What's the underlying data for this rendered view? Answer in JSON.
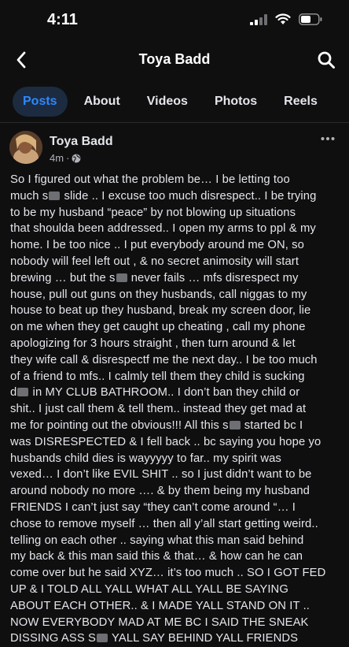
{
  "status_bar": {
    "time": "4:11"
  },
  "nav": {
    "title": "Toya Badd",
    "back_icon": "chevron-left-icon",
    "search_icon": "search-icon"
  },
  "tabs": [
    {
      "label": "Posts",
      "active": true
    },
    {
      "label": "About",
      "active": false
    },
    {
      "label": "Videos",
      "active": false
    },
    {
      "label": "Photos",
      "active": false
    },
    {
      "label": "Reels",
      "active": false
    }
  ],
  "post": {
    "author": "Toya Badd",
    "time": "4m",
    "separator": "·",
    "audience_icon": "globe-icon",
    "more_icon": "more-horizontal-icon",
    "body_lines": [
      [
        "So I figured out what the problem be… I be letting too"
      ],
      [
        "much s",
        " slide .. I excuse too much disrespect.. I be trying"
      ],
      [
        "to be my husband “peace” by not blowing up situations"
      ],
      [
        "that shoulda been addressed.. I open my arms to ppl & my"
      ],
      [
        "home. I be too nice .. I put everybody around me ON, so"
      ],
      [
        "nobody will feel left out , & no secret animosity will start"
      ],
      [
        "brewing … but the s",
        " never fails … mfs disrespect my"
      ],
      [
        "house, pull out guns on they husbands, call niggas to my"
      ],
      [
        "house to beat up they husband, break my screen door, lie"
      ],
      [
        "on me when they get caught up cheating , call my phone"
      ],
      [
        "apologizing for 3 hours straight , then turn around & let"
      ],
      [
        "they wife call & disrespectf me the next day.. I be too much"
      ],
      [
        "of a friend to mfs.. I calmly tell them they child is sucking"
      ],
      [
        "d",
        " in MY CLUB BATHROOM.. I don’t ban they child or"
      ],
      [
        "shit.. I just call them & tell them.. instead they get mad at"
      ],
      [
        "me for pointing out the obvious!!! All this s",
        " started bc I"
      ],
      [
        "was DISRESPECTED & I fell back .. bc saying you hope yo"
      ],
      [
        "husbands child dies is wayyyyy to far.. my spirit was"
      ],
      [
        "vexed… I don’t like EVIL SHIT .. so I just didn’t want to be"
      ],
      [
        "around nobody no more …. & by them being my husband"
      ],
      [
        "FRIENDS I can’t just say “they can’t come around “… I"
      ],
      [
        "chose to remove myself … then all y’all start getting weird.."
      ],
      [
        "telling on each other .. saying what this man said behind"
      ],
      [
        "my back & this man said this & that… & how can he can"
      ],
      [
        "come over but he said XYZ… it’s too much .. SO I GOT FED"
      ],
      [
        "UP & I TOLD ALL YALL WHAT ALL YALL BE SAYING"
      ],
      [
        "ABOUT EACH OTHER.. & I MADE YALL STAND ON IT .."
      ],
      [
        "NOW EVERYBODY MAD AT ME BC I SAID THE SNEAK"
      ],
      [
        "DISSING ASS S",
        " YALL SAY BEHIND YALL FRIENDS"
      ]
    ]
  },
  "colors": {
    "background": "#0f0f10",
    "text": "#e4e6eb",
    "secondary_text": "#b0b3b8",
    "accent": "#2d88ff",
    "active_tab_bg": "#1c2b40"
  }
}
